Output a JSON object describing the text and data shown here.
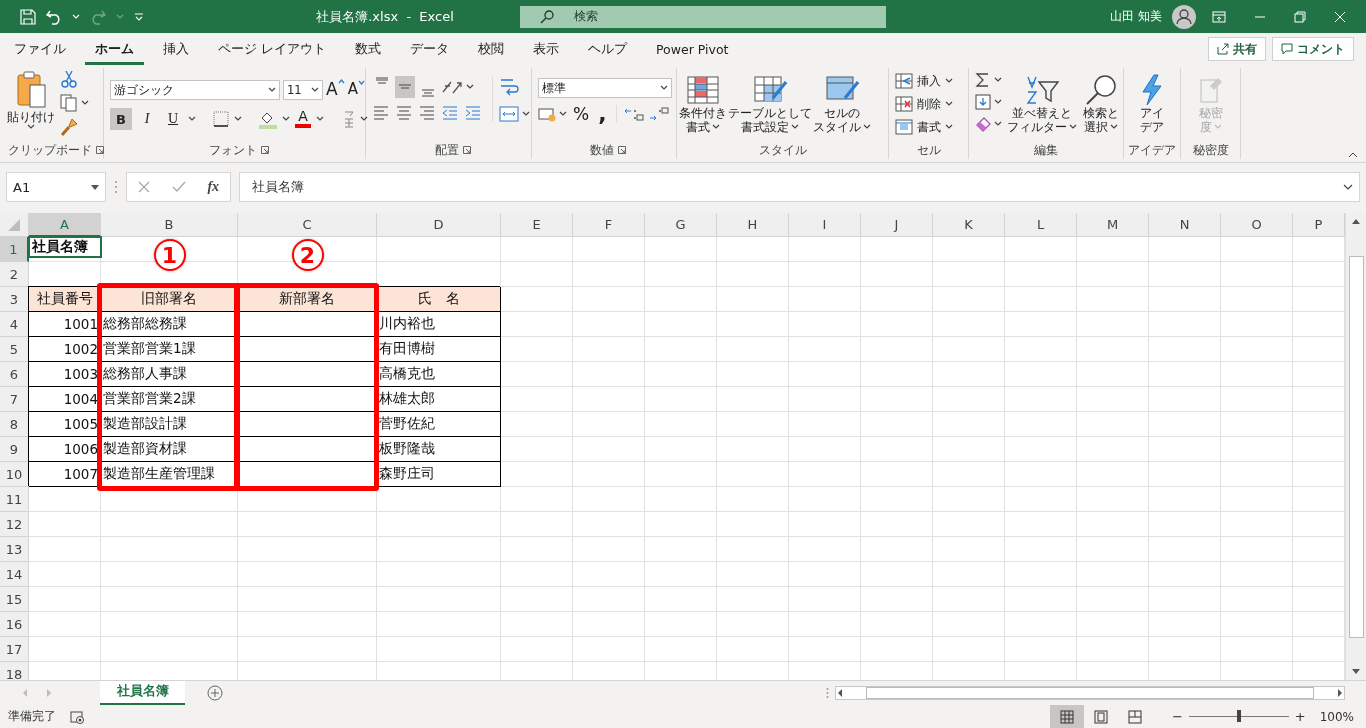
{
  "title_bar": {
    "title": "社員名簿.xlsx  -  Excel",
    "search_placeholder": "検索",
    "user": "山田 知美"
  },
  "menu_tabs": [
    {
      "label": "ファイル",
      "selected": false
    },
    {
      "label": "ホーム",
      "selected": true
    },
    {
      "label": "挿入",
      "selected": false
    },
    {
      "label": "ページ レイアウト",
      "selected": false
    },
    {
      "label": "数式",
      "selected": false
    },
    {
      "label": "データ",
      "selected": false
    },
    {
      "label": "校閲",
      "selected": false
    },
    {
      "label": "表示",
      "selected": false
    },
    {
      "label": "ヘルプ",
      "selected": false
    },
    {
      "label": "Power Pivot",
      "selected": false
    }
  ],
  "share_button": "共有",
  "comment_button": "コメント",
  "ribbon": {
    "clipboard": {
      "paste": "貼り付け",
      "group": "クリップボード"
    },
    "font": {
      "name": "游ゴシック",
      "size": "11",
      "grow": "A",
      "shrink": "A",
      "styles": [
        {
          "label": "B",
          "pressed": true
        },
        {
          "label": "I",
          "pressed": false
        },
        {
          "label": "U",
          "pressed": false
        }
      ],
      "font_color": "A",
      "group": "フォント"
    },
    "alignment": {
      "vertical": [
        {
          "kind": "top",
          "pressed": false
        },
        {
          "kind": "middle",
          "pressed": true
        },
        {
          "kind": "bottom",
          "pressed": false
        }
      ],
      "group": "配置"
    },
    "number": {
      "format": "標準",
      "percent": "%",
      "comma": ",",
      "group": "数値"
    },
    "styles": {
      "buttons": [
        {
          "kind": "conditional",
          "lines": [
            "条件付き",
            "書式"
          ]
        },
        {
          "kind": "table",
          "lines": [
            "テーブルとして",
            "書式設定"
          ]
        },
        {
          "kind": "cell",
          "lines": [
            "セルの",
            "スタイル"
          ]
        }
      ],
      "group": "スタイル"
    },
    "cells": {
      "buttons": [
        {
          "kind": "insert",
          "label": "挿入"
        },
        {
          "kind": "delete",
          "label": "削除"
        },
        {
          "kind": "format",
          "label": "書式"
        }
      ],
      "group": "セル"
    },
    "editing": {
      "buttons": [
        {
          "kind": "sort",
          "lines": [
            "並べ替えと",
            "フィルター"
          ]
        },
        {
          "kind": "find",
          "lines": [
            "検索と",
            "選択"
          ]
        }
      ],
      "group": "編集"
    },
    "ideas": {
      "lines": [
        "アイ",
        "デア"
      ],
      "group": "アイデア"
    },
    "sensitivity": {
      "lines": [
        "秘密",
        "度"
      ],
      "disabled": true,
      "group": "秘密度"
    }
  },
  "formula_bar": {
    "name_box": "A1",
    "function_label": "fx",
    "formula": "社員名簿"
  },
  "columns": [
    {
      "label": "A",
      "selected": true
    },
    {
      "label": "B",
      "selected": false
    },
    {
      "label": "C",
      "selected": false
    },
    {
      "label": "D",
      "selected": false
    },
    {
      "label": "E",
      "selected": false
    },
    {
      "label": "F",
      "selected": false
    },
    {
      "label": "G",
      "selected": false
    },
    {
      "label": "H",
      "selected": false
    },
    {
      "label": "I",
      "selected": false
    },
    {
      "label": "J",
      "selected": false
    },
    {
      "label": "K",
      "selected": false
    },
    {
      "label": "L",
      "selected": false
    },
    {
      "label": "M",
      "selected": false
    },
    {
      "label": "N",
      "selected": false
    },
    {
      "label": "O",
      "selected": false
    },
    {
      "label": "P",
      "selected": false
    }
  ],
  "rows": [
    {
      "label": "1",
      "selected": true,
      "cells": [
        {
          "kind": "title",
          "text": "社員名簿",
          "selected": true
        }
      ]
    },
    {
      "label": "2",
      "selected": false,
      "cells": []
    },
    {
      "label": "3",
      "selected": false,
      "cells": [
        {
          "kind": "header",
          "text": "社員番号"
        },
        {
          "kind": "header",
          "text": "旧部署名"
        },
        {
          "kind": "header",
          "text": "新部署名"
        },
        {
          "kind": "header",
          "text": "氏　名"
        }
      ]
    },
    {
      "label": "4",
      "selected": false,
      "cells": [
        {
          "kind": "number",
          "text": "1001"
        },
        {
          "kind": "text",
          "text": "総務部総務課"
        },
        {
          "kind": "blank"
        },
        {
          "kind": "text",
          "text": "川内裕也"
        }
      ]
    },
    {
      "label": "5",
      "selected": false,
      "cells": [
        {
          "kind": "number",
          "text": "1002"
        },
        {
          "kind": "text",
          "text": "営業部営業1課"
        },
        {
          "kind": "blank"
        },
        {
          "kind": "text",
          "text": "有田博樹"
        }
      ]
    },
    {
      "label": "6",
      "selected": false,
      "cells": [
        {
          "kind": "number",
          "text": "1003"
        },
        {
          "kind": "text",
          "text": "総務部人事課"
        },
        {
          "kind": "blank"
        },
        {
          "kind": "text",
          "text": "高橋克也"
        }
      ]
    },
    {
      "label": "7",
      "selected": false,
      "cells": [
        {
          "kind": "number",
          "text": "1004"
        },
        {
          "kind": "text",
          "text": "営業部営業2課"
        },
        {
          "kind": "blank"
        },
        {
          "kind": "text",
          "text": "林雄太郎"
        }
      ]
    },
    {
      "label": "8",
      "selected": false,
      "cells": [
        {
          "kind": "number",
          "text": "1005"
        },
        {
          "kind": "text",
          "text": "製造部設計課"
        },
        {
          "kind": "blank"
        },
        {
          "kind": "text",
          "text": "菅野佐紀"
        }
      ]
    },
    {
      "label": "9",
      "selected": false,
      "cells": [
        {
          "kind": "number",
          "text": "1006"
        },
        {
          "kind": "text",
          "text": "製造部資材課"
        },
        {
          "kind": "blank"
        },
        {
          "kind": "text",
          "text": "板野隆哉"
        }
      ]
    },
    {
      "label": "10",
      "selected": false,
      "cells": [
        {
          "kind": "number",
          "text": "1007"
        },
        {
          "kind": "text",
          "text": "製造部生産管理課"
        },
        {
          "kind": "blank"
        },
        {
          "kind": "text",
          "text": "森野庄司"
        }
      ]
    },
    {
      "label": "11",
      "selected": false,
      "cells": []
    },
    {
      "label": "12",
      "selected": false,
      "cells": []
    },
    {
      "label": "13",
      "selected": false,
      "cells": []
    },
    {
      "label": "14",
      "selected": false,
      "cells": []
    },
    {
      "label": "15",
      "selected": false,
      "cells": []
    },
    {
      "label": "16",
      "selected": false,
      "cells": []
    },
    {
      "label": "17",
      "selected": false,
      "cells": []
    },
    {
      "label": "18",
      "selected": false,
      "cells": []
    }
  ],
  "callouts": [
    {
      "number": "1"
    },
    {
      "number": "2"
    }
  ],
  "sheet_tabs": [
    {
      "label": "社員名簿",
      "selected": true
    }
  ],
  "status_bar": {
    "status": "準備完了",
    "views": [
      {
        "kind": "normal",
        "selected": true
      },
      {
        "kind": "page_layout",
        "selected": false
      },
      {
        "kind": "page_break",
        "selected": false
      }
    ],
    "zoom": {
      "minus": "−",
      "plus": "+",
      "level": 0.5,
      "reading": "100%"
    }
  }
}
